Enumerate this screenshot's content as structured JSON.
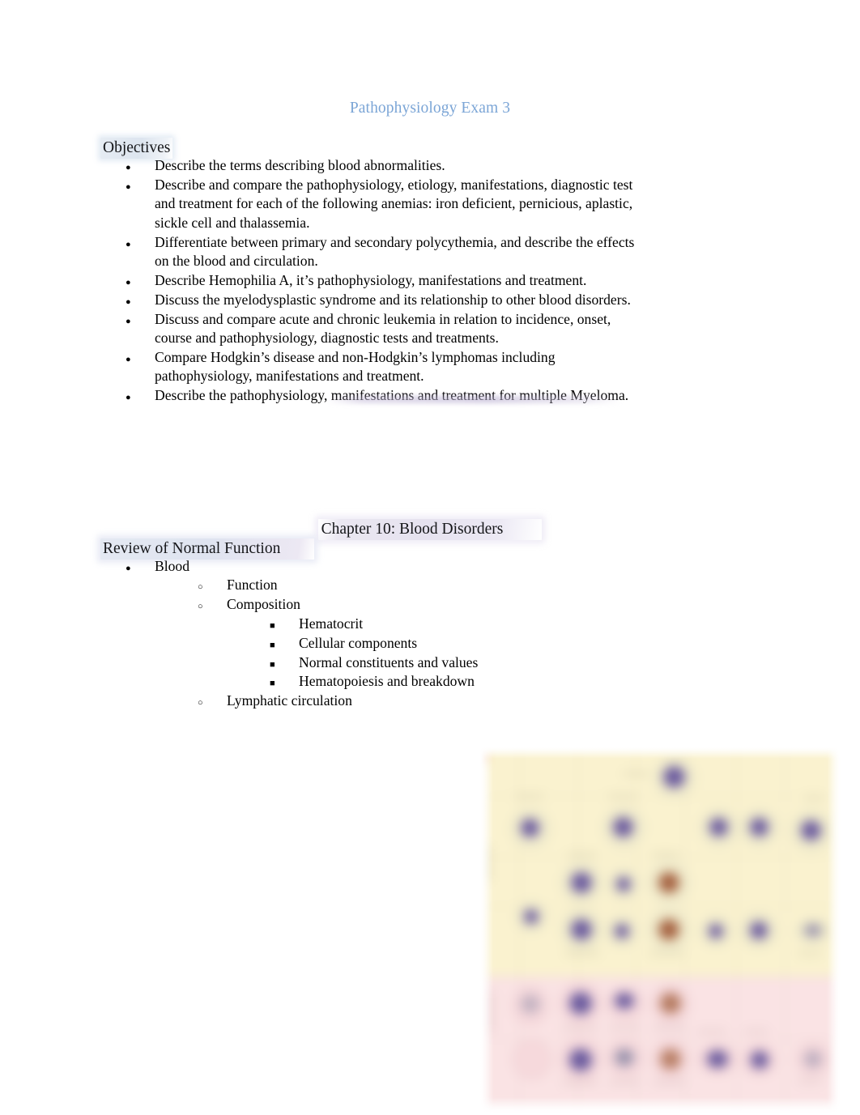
{
  "document": {
    "title": "Pathophysiology Exam 3",
    "title_color": "#7ba5d6",
    "background_color": "#ffffff",
    "text_color": "#000000"
  },
  "sections": [
    {
      "heading": "Objectives",
      "heading_highlight_color": "#dde5ef",
      "items": [
        {
          "level": 1,
          "marker": "disc",
          "text": "Describe the terms describing blood abnormalities."
        },
        {
          "level": 1,
          "marker": "disc",
          "text": "Describe and compare the pathophysiology, etiology, manifestations, diagnostic test and treatment for each of the following anemias: iron deficient, pernicious, aplastic, sickle cell and thalassemia."
        },
        {
          "level": 1,
          "marker": "disc",
          "text": "Differentiate between primary and secondary polycythemia, and describe the effects on the blood and circulation."
        },
        {
          "level": 1,
          "marker": "disc",
          "text": "Describe Hemophilia A, it’s pathophysiology, manifestations and treatment."
        },
        {
          "level": 1,
          "marker": "disc",
          "text": "Discuss the myelodysplastic syndrome and its relationship to other blood disorders."
        },
        {
          "level": 1,
          "marker": "disc",
          "text": "Discuss and compare acute and chronic leukemia in relation to incidence, onset, course and pathophysiology, diagnostic tests and treatments."
        },
        {
          "level": 1,
          "marker": "disc",
          "text": "Compare Hodgkin’s disease and non-Hodgkin’s lymphomas including pathophysiology, manifestations and treatment."
        },
        {
          "level": 1,
          "marker": "disc",
          "text": "Describe the pathophysiology, manifestations and treatment for multiple Myeloma."
        }
      ]
    },
    {
      "chapter_heading": "Chapter 10: Blood Disorders",
      "chapter_heading_highlight_color": "#e6e2ef",
      "heading": "Review of Normal Function",
      "heading_highlight_color": "#dfe4f0",
      "outline": [
        {
          "marker": "disc",
          "text": "Blood",
          "children": [
            {
              "marker": "circle",
              "text": "Function",
              "children": []
            },
            {
              "marker": "circle",
              "text": "Composition",
              "children": [
                {
                  "marker": "square",
                  "text": "Hematocrit"
                },
                {
                  "marker": "square",
                  "text": "Cellular components"
                },
                {
                  "marker": "square",
                  "text": "Normal constituents and values"
                },
                {
                  "marker": "square",
                  "text": "Hematopoiesis and breakdown"
                }
              ]
            },
            {
              "marker": "circle",
              "text": "Lymphatic circulation",
              "children": []
            }
          ]
        }
      ]
    }
  ],
  "figure": {
    "name": "hematopoiesis-chart",
    "description": "Blurred hematopoiesis / blood cell maturation chart",
    "band_top_color": "#faf2cf",
    "band_bottom_color": "#fae3e4",
    "nucleus_color": "#6a5a9e",
    "nucleus_brown_color": "#a4603f",
    "red_cell_color": "#e8492b",
    "legible_text": ""
  }
}
